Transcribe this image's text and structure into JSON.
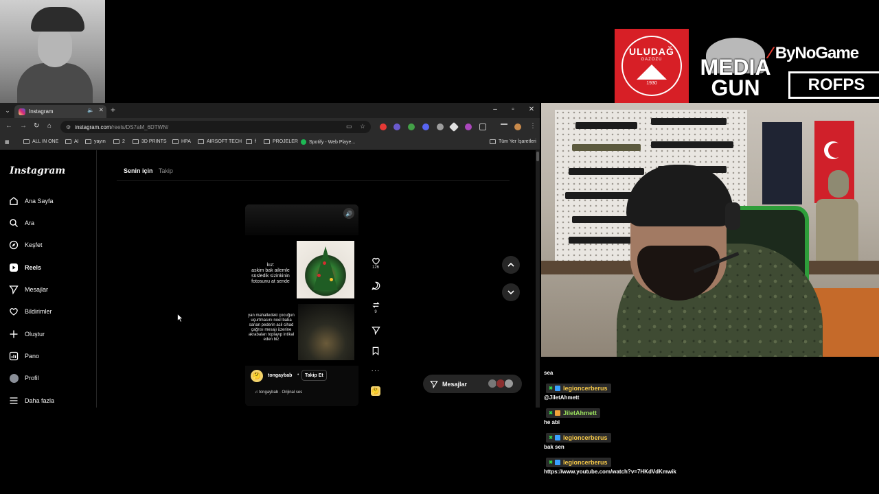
{
  "browser": {
    "tab_title": "Instagram",
    "url_host": "instagram.com",
    "url_path": "/reels/DS7aM_6DTWN/",
    "bookmarks": [
      "ALL IN ONE",
      "AI",
      "yayın",
      "2",
      "3D PRINTS",
      "HPA",
      "AIRSOFT TECH",
      "f",
      "PROJELER",
      "Spotify - Web Playe...",
      "Tüm Yer İşaretleri"
    ]
  },
  "instagram": {
    "logo": "Instagram",
    "nav": [
      "Ana Sayfa",
      "Ara",
      "Keşfet",
      "Reels",
      "Mesajlar",
      "Bildirimler",
      "Oluştur",
      "Pano",
      "Profil",
      "Daha fazla"
    ],
    "tabs": {
      "for_you": "Senin için",
      "following": "Takip"
    },
    "reel": {
      "caption_top": "kız:\naskim bak ailemle süsledik sizinkinin fotosunu at sende",
      "caption_bottom": "yan mahalledeki çocuğun uçurtmasını noel baba sanan pederin acil cihad çağrısı mesajı üzerine akrabaları toplayıp intikal eden biz",
      "username": "tongaybab",
      "dot": "•",
      "follow": "Takip Et",
      "audio": "tongaybab · Orijinal ses",
      "likes": "126",
      "reposts": "9"
    },
    "messages_label": "Mesajlar"
  },
  "sponsors": {
    "uludag": "ULUDAĞ",
    "uludag_sub": "GAZOZU",
    "uludag_year": "1930",
    "media_1": "MEDIA",
    "media_2": "GUN",
    "bynogame": "ByNoGame",
    "rofps": "ROFPS"
  },
  "chat": [
    {
      "type": "msg",
      "text": "sea"
    },
    {
      "type": "user",
      "name": "legioncerberus",
      "badge": "b"
    },
    {
      "type": "msg",
      "text": "@JiletAhmett"
    },
    {
      "type": "user",
      "name": "JiletAhmett",
      "badge": "c"
    },
    {
      "type": "msg",
      "text": "he abi"
    },
    {
      "type": "user",
      "name": "legioncerberus",
      "badge": "b"
    },
    {
      "type": "msg",
      "text": "bak sen"
    },
    {
      "type": "user",
      "name": "legioncerberus",
      "badge": "b"
    },
    {
      "type": "msg",
      "text": "https://www.youtube.com/watch?v=7HKdVdKmwik"
    }
  ],
  "colors": {
    "accent_chat_name": "#f7c948",
    "spotify": "#1db954",
    "uludag_red": "#d71f26"
  }
}
